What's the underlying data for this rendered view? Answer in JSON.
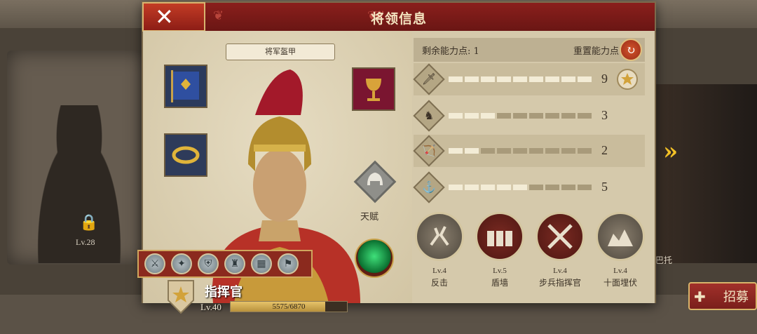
{
  "background": {
    "left_hero_level": "Lv.28",
    "right_hero_name": "巴托"
  },
  "recruit_label": "招募",
  "panel": {
    "title": "将领信息",
    "armor_label": "将军盔甲",
    "talent_label": "天赋",
    "commander": {
      "title": "指挥官",
      "level": "Lv.40",
      "exp_current": 5575,
      "exp_max": 6870,
      "exp_text": "5575/6870"
    },
    "skill_icons": [
      "counter-icon",
      "shield-wall-icon",
      "defense-icon",
      "helmet-icon",
      "formation-icon",
      "banner-icon"
    ],
    "points": {
      "label": "剩余能力点: 1",
      "reset_label": "重置能力点"
    },
    "stats": [
      {
        "name": "sword-stat",
        "value": "9",
        "filled": 9,
        "segments": 9,
        "star": true
      },
      {
        "name": "horse-stat",
        "value": "3",
        "filled": 3,
        "segments": 9,
        "star": false
      },
      {
        "name": "bow-stat",
        "value": "2",
        "filled": 2,
        "segments": 9,
        "star": false
      },
      {
        "name": "anchor-stat",
        "value": "5",
        "filled": 5,
        "segments": 9,
        "star": false
      }
    ],
    "skills": [
      {
        "level": "Lv.4",
        "name": "反击",
        "style": "dark"
      },
      {
        "level": "Lv.5",
        "name": "盾墙",
        "style": "red"
      },
      {
        "level": "Lv.4",
        "name": "步兵指挥官",
        "style": "red"
      },
      {
        "level": "Lv.4",
        "name": "十面埋伏",
        "style": "dark"
      }
    ]
  }
}
